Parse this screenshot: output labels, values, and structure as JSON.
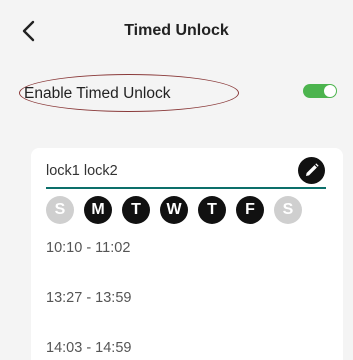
{
  "header": {
    "title": "Timed Unlock",
    "back_icon": "chevron-left-icon"
  },
  "enable": {
    "label": "Enable Timed Unlock",
    "toggle_on": true,
    "toggle_color": "#4cb44e"
  },
  "schedule": {
    "name": "lock1 lock2",
    "edit_icon": "pencil-icon",
    "accent_color": "#0c6f6a",
    "days": [
      {
        "letter": "S",
        "active": false
      },
      {
        "letter": "M",
        "active": true
      },
      {
        "letter": "T",
        "active": true
      },
      {
        "letter": "W",
        "active": true
      },
      {
        "letter": "T",
        "active": true
      },
      {
        "letter": "F",
        "active": true
      },
      {
        "letter": "S",
        "active": false
      }
    ],
    "times": [
      "10:10 - 11:02",
      "13:27 - 13:59",
      "14:03 - 14:59"
    ]
  }
}
